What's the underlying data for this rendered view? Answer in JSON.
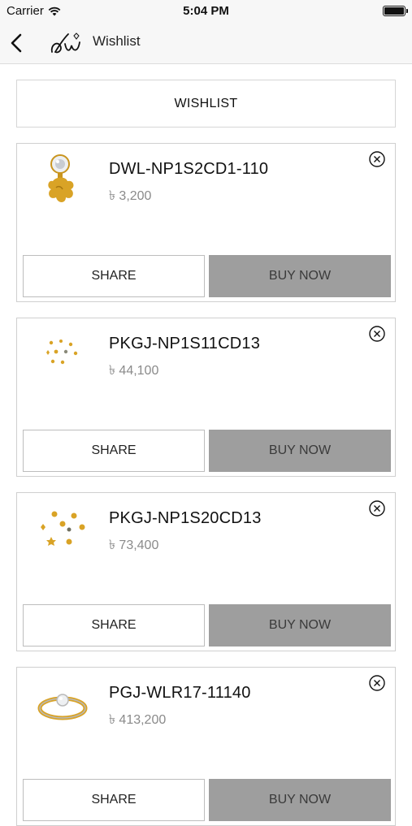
{
  "status_bar": {
    "carrier": "Carrier",
    "time": "5:04 PM"
  },
  "nav": {
    "title": "Wishlist"
  },
  "section": {
    "title": "WISHLIST"
  },
  "items": [
    {
      "name": "DWL-NP1S2CD1-110",
      "price": "৳ 3,200",
      "share_label": "SHARE",
      "buy_label": "BUY NOW"
    },
    {
      "name": "PKGJ-NP1S11CD13",
      "price": "৳ 44,100",
      "share_label": "SHARE",
      "buy_label": "BUY NOW"
    },
    {
      "name": "PKGJ-NP1S20CD13",
      "price": "৳ 73,400",
      "share_label": "SHARE",
      "buy_label": "BUY NOW"
    },
    {
      "name": "PGJ-WLR17-11140",
      "price": "৳ 413,200",
      "share_label": "SHARE",
      "buy_label": "BUY NOW"
    }
  ]
}
